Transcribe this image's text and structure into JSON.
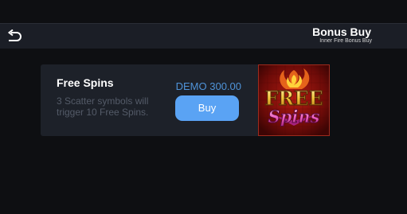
{
  "header": {
    "back_icon": "undo-arrow-icon",
    "title": "Bonus Buy",
    "subtitle": "Inner Fire Bonus Buy"
  },
  "bonus_card": {
    "title": "Free Spins",
    "description": "3 Scatter symbols will trigger 10 Free Spins.",
    "price": "DEMO 300.00",
    "buy_label": "Buy",
    "art": {
      "text_top": "FREE",
      "text_bottom": "Spins",
      "icon": "free-spins-art"
    }
  },
  "colors": {
    "background": "#0e0f12",
    "header": "#1b1e26",
    "card": "#1d2129",
    "price_text": "#4f93d8",
    "buy_button": "#5aa3f4",
    "description_text": "#545b68"
  }
}
